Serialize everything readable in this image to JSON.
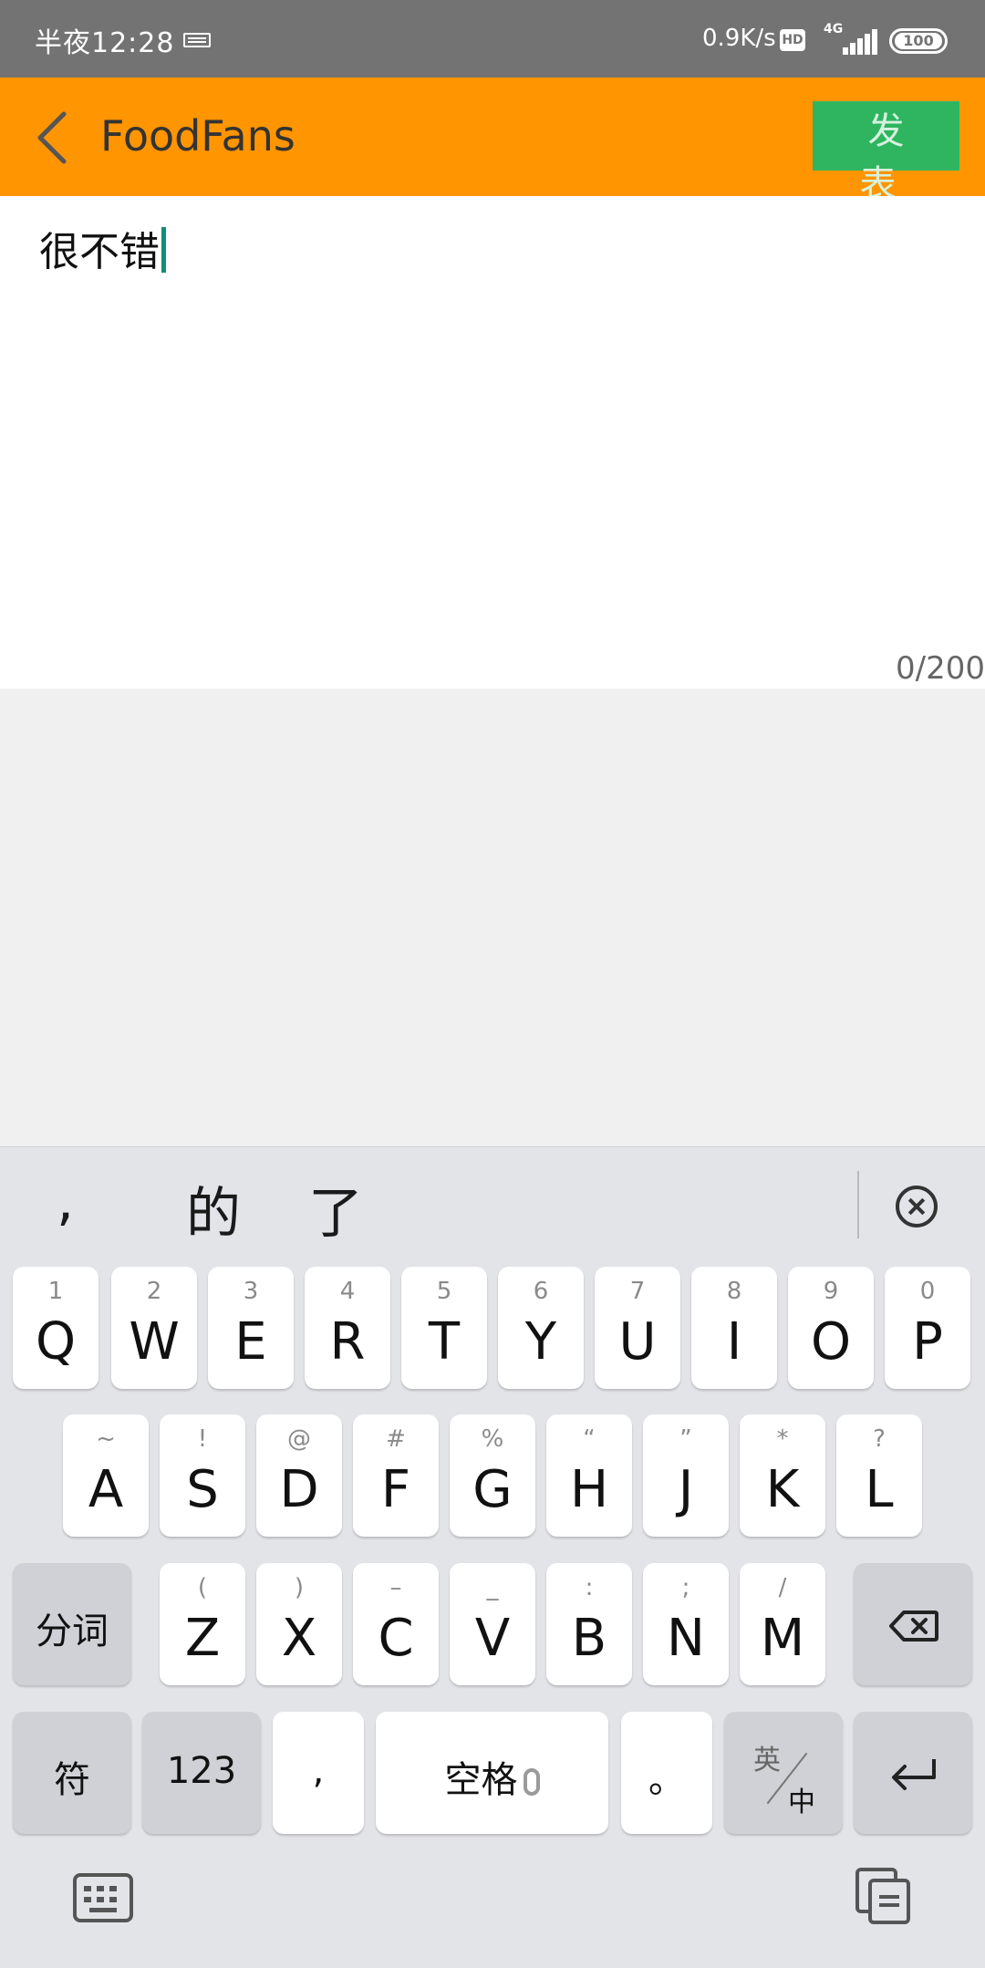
{
  "status_bar": {
    "time": "半夜12:28",
    "speed": "0.9K/s",
    "hd": "HD",
    "network": "4G",
    "battery": "100"
  },
  "app_bar": {
    "title": "FoodFans",
    "publish_label": "发 表"
  },
  "editor": {
    "text": "很不错",
    "counter": "0/200"
  },
  "keyboard": {
    "suggestions": [
      ",",
      "的",
      "了"
    ],
    "row1": [
      {
        "hint": "1",
        "key": "Q"
      },
      {
        "hint": "2",
        "key": "W"
      },
      {
        "hint": "3",
        "key": "E"
      },
      {
        "hint": "4",
        "key": "R"
      },
      {
        "hint": "5",
        "key": "T"
      },
      {
        "hint": "6",
        "key": "Y"
      },
      {
        "hint": "7",
        "key": "U"
      },
      {
        "hint": "8",
        "key": "I"
      },
      {
        "hint": "9",
        "key": "O"
      },
      {
        "hint": "0",
        "key": "P"
      }
    ],
    "row2": [
      {
        "hint": "~",
        "key": "A"
      },
      {
        "hint": "!",
        "key": "S"
      },
      {
        "hint": "@",
        "key": "D"
      },
      {
        "hint": "#",
        "key": "F"
      },
      {
        "hint": "%",
        "key": "G"
      },
      {
        "hint": "“",
        "key": "H"
      },
      {
        "hint": "”",
        "key": "J"
      },
      {
        "hint": "*",
        "key": "K"
      },
      {
        "hint": "?",
        "key": "L"
      }
    ],
    "row3": [
      {
        "hint": "(",
        "key": "Z"
      },
      {
        "hint": ")",
        "key": "X"
      },
      {
        "hint": "–",
        "key": "C"
      },
      {
        "hint": "_",
        "key": "V"
      },
      {
        "hint": ":",
        "key": "B"
      },
      {
        "hint": ";",
        "key": "N"
      },
      {
        "hint": "/",
        "key": "M"
      }
    ],
    "segment_label": "分词",
    "symbol_label": "符",
    "numbers_label": "123",
    "comma_label": ",",
    "space_label": "空格",
    "period_label": "。",
    "lang_en": "英",
    "lang_zh": "中"
  }
}
